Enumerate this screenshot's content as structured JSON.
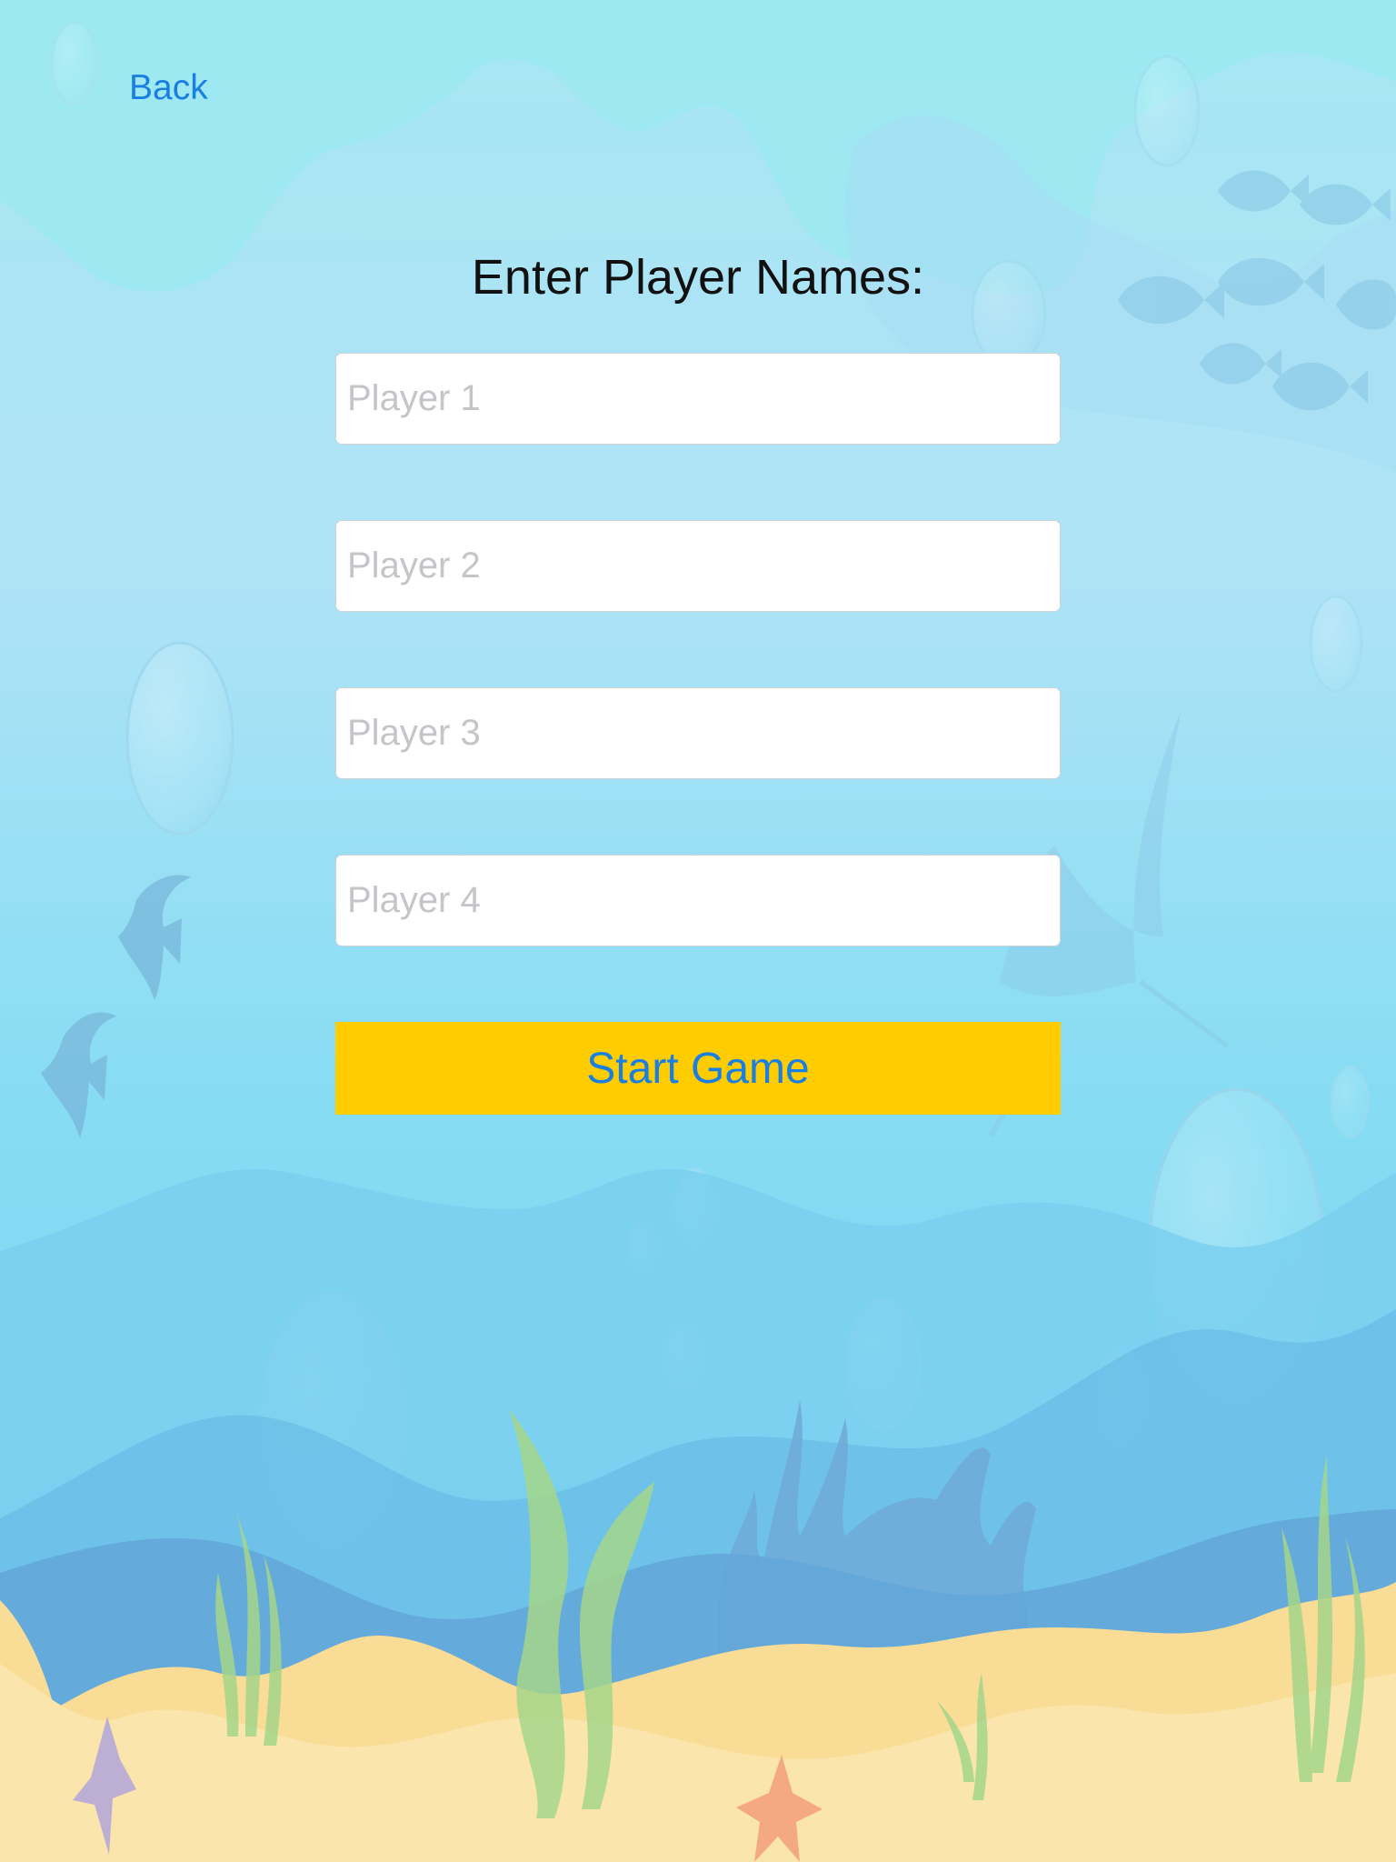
{
  "nav": {
    "back_label": "Back"
  },
  "form": {
    "title": "Enter Player Names:",
    "players": [
      {
        "value": "",
        "placeholder": "Player 1"
      },
      {
        "value": "",
        "placeholder": "Player 2"
      },
      {
        "value": "",
        "placeholder": "Player 3"
      },
      {
        "value": "",
        "placeholder": "Player 4"
      }
    ],
    "start_label": "Start Game"
  },
  "theme": {
    "accent": "#1a7fe3",
    "button_color": "#ffcc00",
    "background": "underwater-scene"
  }
}
